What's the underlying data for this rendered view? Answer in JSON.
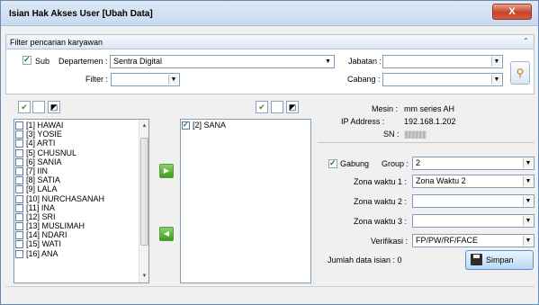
{
  "window": {
    "title": "Isian Hak Akses User [Ubah Data]",
    "close_label": "X"
  },
  "filter": {
    "header": "Filter pencarian karyawan",
    "sub_label": "Sub",
    "sub_checked": true,
    "departemen_label": "Departemen :",
    "departemen_value": "Sentra Digital",
    "jabatan_label": "Jabatan :",
    "jabatan_value": "",
    "filter_label": "Filter :",
    "filter_value": "",
    "cabang_label": "Cabang :",
    "cabang_value": ""
  },
  "left_list": {
    "items": [
      "[1] HAWAI",
      "[3] YOSIE",
      "[4] ARTI",
      "[5] CHUSNUL",
      "[6] SANIA",
      "[7] IIN",
      "[8] SATIA",
      "[9] LALA",
      "[10] NURCHASANAH",
      "[11] INA",
      "[12] SRI",
      "[13] MUSLIMAH",
      "[14] NDARI",
      "[15] WATI",
      "[16] ANA"
    ]
  },
  "right_list": {
    "items": [
      "[2] SANA"
    ]
  },
  "info": {
    "mesin_label": "Mesin :",
    "mesin_value": "mm series AH",
    "ip_label": "IP Address :",
    "ip_value": "192.168.1.202",
    "sn_label": "SN :",
    "sn_value": "||||||||||||||||||"
  },
  "settings": {
    "gabung_label": "Gabung",
    "gabung_checked": true,
    "group_label": "Group :",
    "group_value": "2",
    "zona1_label": "Zona waktu 1 :",
    "zona1_value": "Zona Waktu 2",
    "zona2_label": "Zona waktu 2 :",
    "zona2_value": "",
    "zona3_label": "Zona waktu 3 :",
    "zona3_value": "",
    "verifikasi_label": "Verifikasi :",
    "verifikasi_value": "FP/PW/RF/FACE",
    "jumlah_label": "Jumlah data isian : 0",
    "save_label": "Simpan"
  }
}
